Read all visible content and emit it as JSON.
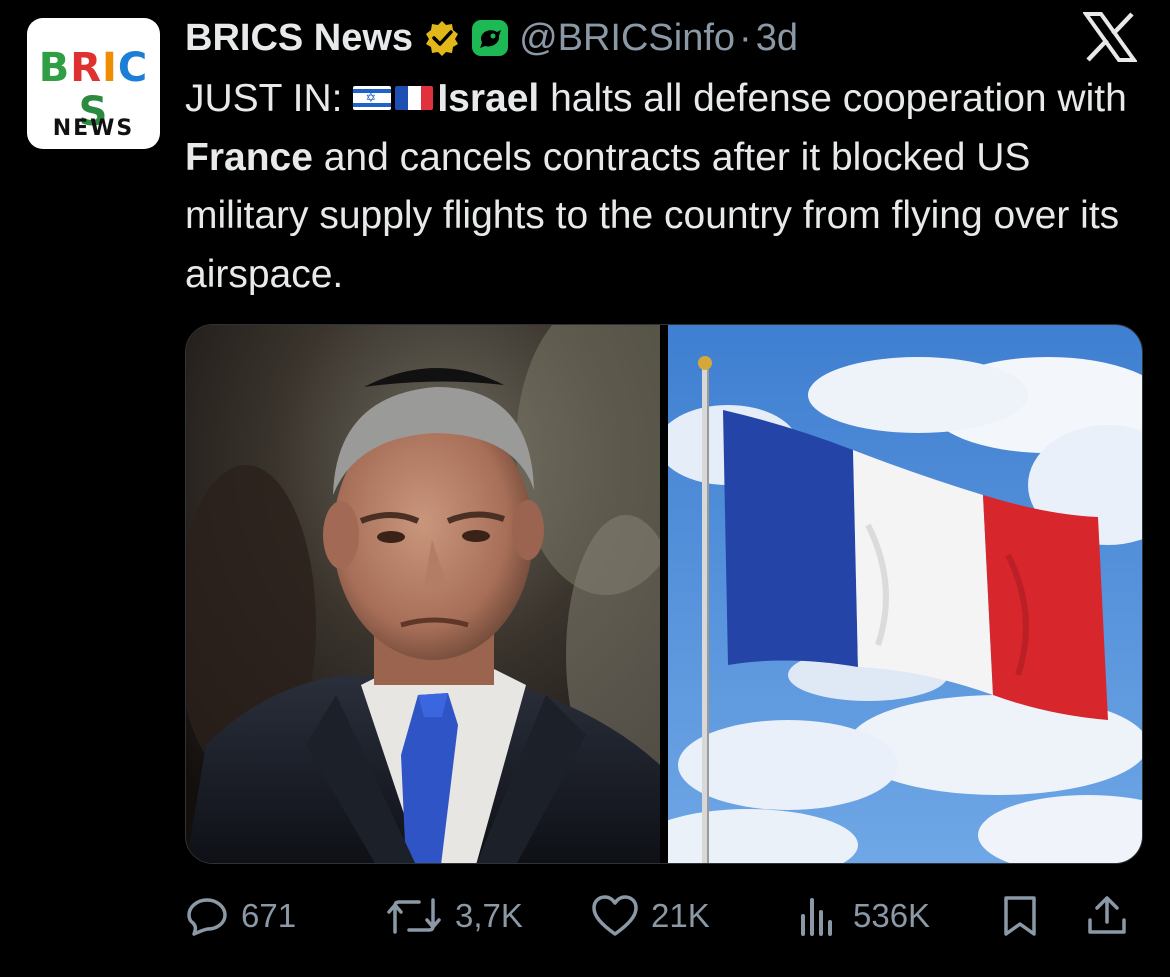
{
  "author": {
    "display_name": "BRICS News",
    "handle": "@BRICSinfo",
    "separator": "·",
    "time": "3d",
    "avatar_logo": "BRICS",
    "avatar_subtitle": "NEWS",
    "verified_badge_color": "#e2b719",
    "affiliate_badge_color": "#1db954"
  },
  "platform_logo": "x-logo",
  "tweet": {
    "prefix": "JUST IN:",
    "bold_subject": "Israel",
    "part1": " halts all defense cooperation with ",
    "bold_object": "France",
    "part2": " and cancels contracts after it blocked US military supply flights to the country from flying over its airspace.",
    "flags": [
      "israel-flag-icon",
      "france-flag-icon"
    ]
  },
  "media": [
    {
      "name": "photo-politician"
    },
    {
      "name": "photo-french-flag"
    }
  ],
  "actions": {
    "replies": "671",
    "reposts": "3,7K",
    "likes": "21K",
    "views": "536K"
  },
  "colors": {
    "background": "#000000",
    "text": "#e7e9ea",
    "secondary": "#8b98a5"
  }
}
